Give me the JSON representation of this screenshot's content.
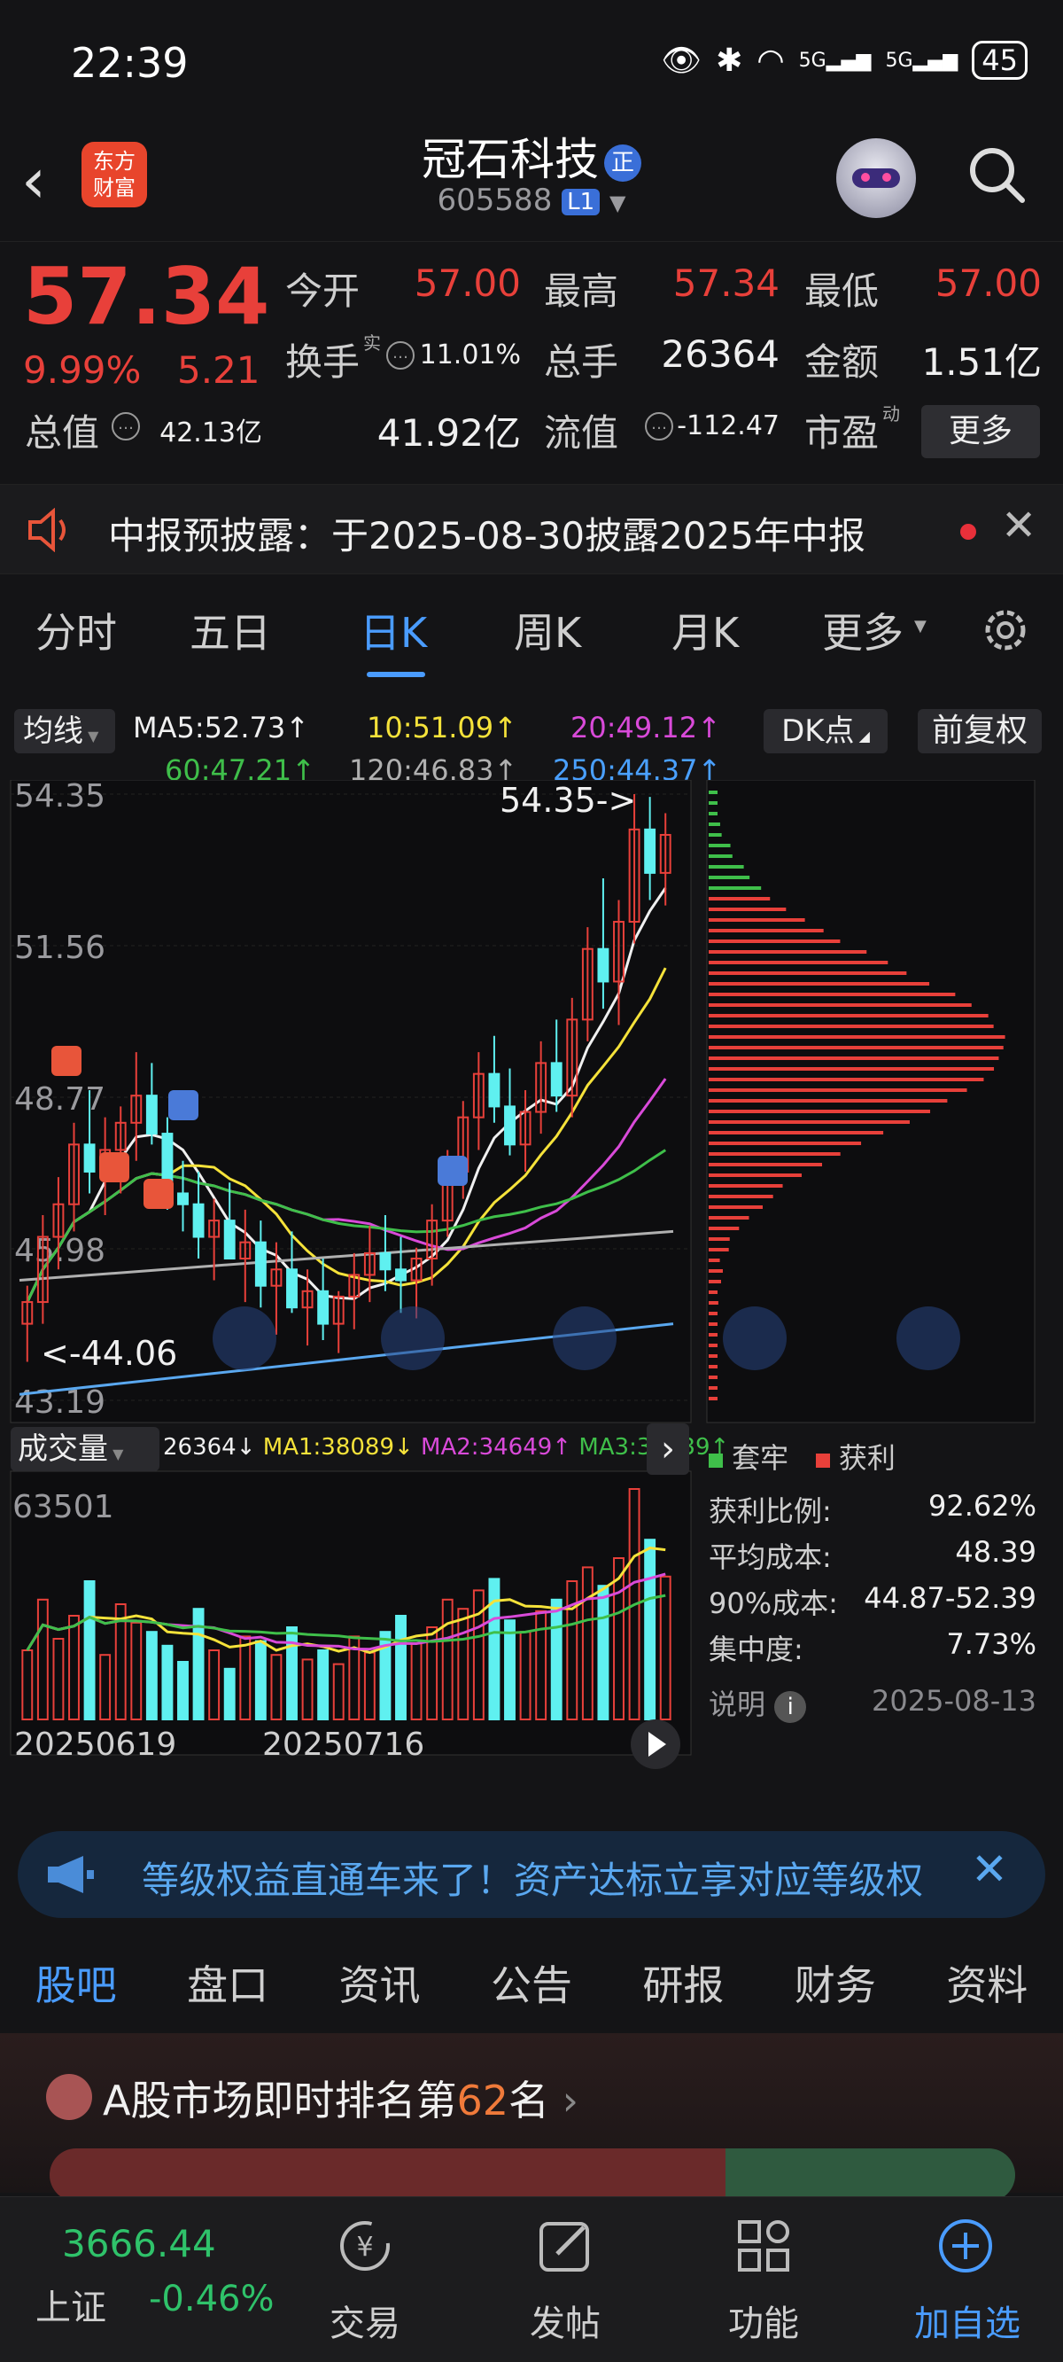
{
  "status_bar": {
    "time": "22:39",
    "battery": "45",
    "signal_label_1": "5G",
    "signal_label_2": "5G"
  },
  "header": {
    "brand_line1": "东方",
    "brand_line2": "财富",
    "stock_name": "冠石科技",
    "stock_badge": "正",
    "stock_code": "605588",
    "level": "L1"
  },
  "quote": {
    "price": "57.34",
    "change_pct": "9.99%",
    "change_amt": "5.21",
    "fields": [
      {
        "label": "今开",
        "value": "57.00",
        "color": "#e8403a"
      },
      {
        "label": "最高",
        "value": "57.34",
        "color": "#e8403a"
      },
      {
        "label": "最低",
        "value": "57.00",
        "color": "#e8403a"
      },
      {
        "label": "换手",
        "sup": "实",
        "value": "11.01%",
        "color": "#f0f0f0"
      },
      {
        "label": "总手",
        "value": "26364",
        "color": "#f0f0f0"
      },
      {
        "label": "金额",
        "value": "1.51亿",
        "color": "#f0f0f0"
      },
      {
        "label": "总值",
        "value": "42.13亿",
        "color": "#f0f0f0"
      },
      {
        "label": "流值",
        "value": "41.92亿",
        "color": "#f0f0f0"
      },
      {
        "label": "市盈",
        "sup": "动",
        "value": "-112.47",
        "color": "#f0f0f0"
      }
    ],
    "more_label": "更多"
  },
  "notice": {
    "text": "中报预披露：于2025-08-30披露2025年中报"
  },
  "ktabs": [
    "分时",
    "五日",
    "日K",
    "周K",
    "月K",
    "更多"
  ],
  "active_ktab": "日K",
  "ma_bar": {
    "selector": "均线",
    "items": [
      {
        "label": "MA5:52.73↑",
        "color": "#f0f0f0"
      },
      {
        "label": "10:51.09↑",
        "color": "#f5e23a"
      },
      {
        "label": "20:49.12↑",
        "color": "#d94ad9"
      },
      {
        "label": "60:47.21↑",
        "color": "#3fbf4a"
      },
      {
        "label": "120:46.83↑",
        "color": "#b0b0b0"
      },
      {
        "label": "250:44.37↑",
        "color": "#4aa0ff"
      }
    ],
    "dk_button": "DK点",
    "adjust_button": "前复权"
  },
  "chart_data": {
    "type": "candlestick",
    "y_ticks": [
      "54.35",
      "51.56",
      "48.77",
      "45.98",
      "43.19"
    ],
    "max_label": "54.35->",
    "min_label": "<-44.06",
    "volume_max": "63501",
    "dates": [
      "20250619",
      "20250716"
    ],
    "volume_header": {
      "selector": "成交量",
      "vol": "26364↓",
      "ma1": "MA1:38089↓",
      "ma2": "MA2:34649↑",
      "ma3": "MA3:30439↑"
    },
    "candles": [
      [
        44.6,
        45.3,
        43.9,
        45.0
      ],
      [
        45.0,
        46.6,
        44.6,
        46.2
      ],
      [
        46.2,
        47.3,
        45.6,
        46.8
      ],
      [
        46.8,
        48.3,
        46.3,
        47.9
      ],
      [
        47.9,
        48.9,
        47.0,
        47.4
      ],
      [
        47.4,
        48.4,
        46.6,
        47.8
      ],
      [
        47.8,
        48.6,
        47.0,
        48.3
      ],
      [
        48.3,
        49.6,
        47.6,
        48.8
      ],
      [
        48.8,
        49.4,
        47.9,
        48.1
      ],
      [
        48.1,
        48.4,
        46.7,
        47.0
      ],
      [
        47.0,
        47.6,
        46.3,
        46.8
      ],
      [
        46.8,
        47.4,
        45.8,
        46.2
      ],
      [
        46.2,
        46.9,
        45.4,
        46.5
      ],
      [
        46.5,
        47.2,
        45.9,
        45.8
      ],
      [
        45.8,
        46.7,
        45.0,
        46.1
      ],
      [
        46.1,
        46.5,
        44.9,
        45.3
      ],
      [
        45.3,
        46.1,
        44.4,
        45.6
      ],
      [
        45.6,
        46.3,
        44.8,
        44.9
      ],
      [
        44.9,
        45.6,
        44.2,
        45.2
      ],
      [
        45.2,
        45.8,
        44.3,
        44.6
      ],
      [
        44.6,
        45.2,
        44.06,
        45.1
      ],
      [
        45.1,
        45.9,
        44.5,
        45.5
      ],
      [
        45.5,
        46.4,
        45.0,
        45.9
      ],
      [
        45.9,
        46.6,
        45.2,
        45.6
      ],
      [
        45.6,
        46.2,
        44.8,
        45.4
      ],
      [
        45.4,
        46.0,
        44.7,
        45.8
      ],
      [
        45.8,
        46.8,
        45.3,
        46.5
      ],
      [
        46.5,
        47.8,
        46.2,
        47.4
      ],
      [
        47.4,
        48.7,
        46.9,
        48.4
      ],
      [
        48.4,
        49.6,
        47.8,
        49.2
      ],
      [
        49.2,
        49.9,
        48.3,
        48.6
      ],
      [
        48.6,
        49.3,
        47.7,
        47.9
      ],
      [
        47.9,
        48.9,
        47.4,
        48.5
      ],
      [
        48.5,
        49.8,
        48.1,
        49.4
      ],
      [
        49.4,
        50.2,
        48.5,
        48.8
      ],
      [
        48.8,
        50.6,
        48.4,
        50.2
      ],
      [
        50.2,
        51.9,
        49.8,
        51.5
      ],
      [
        51.5,
        52.8,
        50.4,
        50.9
      ],
      [
        50.9,
        52.4,
        50.1,
        52.0
      ],
      [
        52.0,
        54.35,
        51.6,
        53.7
      ],
      [
        53.7,
        54.3,
        52.4,
        52.9
      ],
      [
        52.9,
        54.0,
        52.3,
        53.6
      ]
    ],
    "volumes": [
      30,
      52,
      35,
      45,
      60,
      28,
      50,
      42,
      38,
      32,
      25,
      48,
      30,
      22,
      36,
      34,
      28,
      40,
      26,
      30,
      24,
      36,
      29,
      38,
      45,
      33,
      40,
      52,
      48,
      56,
      61,
      43,
      38,
      47,
      52,
      60,
      66,
      58,
      70,
      100,
      78,
      62
    ]
  },
  "chip": {
    "legend_trapped": "套牢",
    "legend_profit": "获利",
    "rows": [
      {
        "label": "获利比例:",
        "value": "92.62%"
      },
      {
        "label": "平均成本:",
        "value": "48.39"
      },
      {
        "label": "90%成本:",
        "value": "44.87-52.39"
      },
      {
        "label": "集中度:",
        "value": "7.73%"
      }
    ],
    "note_label": "说明",
    "date": "2025-08-13"
  },
  "promo": {
    "text": "等级权益直通车来了！资产达标立享对应等级权"
  },
  "section_tabs": [
    "股吧",
    "盘口",
    "资讯",
    "公告",
    "研报",
    "财务",
    "资料"
  ],
  "active_section": "股吧",
  "ranking": {
    "prefix": "A股市场即时排名第",
    "rank": "62",
    "suffix": "名"
  },
  "bottom_bar": {
    "index_value": "3666.44",
    "index_name": "上证",
    "index_change": "-0.46%",
    "items": [
      {
        "label": "交易"
      },
      {
        "label": "发帖"
      },
      {
        "label": "功能"
      },
      {
        "label": "加自选"
      }
    ]
  },
  "colors": {
    "up": "#e8403a",
    "down": "#5ff0f0",
    "accent": "#4a9cff",
    "background": "#141416"
  }
}
